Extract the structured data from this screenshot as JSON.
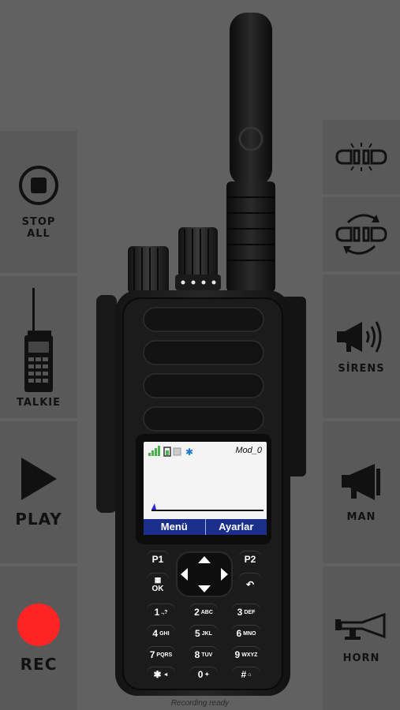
{
  "left_panel": {
    "stop_all": {
      "label_line1": "STOP",
      "label_line2": "ALL",
      "icon": "stop-icon"
    },
    "talkie": {
      "label": "TALKIE",
      "icon": "walkie-talkie-icon"
    },
    "play": {
      "label": "PLAY",
      "icon": "play-icon"
    },
    "rec": {
      "label": "REC",
      "icon": "record-icon",
      "color": "#ff2424"
    }
  },
  "right_panel": {
    "lightbar": {
      "icon": "lightbar-icon"
    },
    "lightbar_rotate": {
      "icon": "lightbar-rotate-icon"
    },
    "sirens": {
      "label": "SİRENS",
      "icon": "siren-speaker-icon"
    },
    "man": {
      "label": "MAN",
      "icon": "megaphone-icon"
    },
    "horn": {
      "label": "HORN",
      "icon": "horn-icon"
    }
  },
  "radio": {
    "screen": {
      "channel": "Mod_0",
      "softkey_left": "Menü",
      "softkey_right": "Ayarlar"
    },
    "keys": {
      "p1": "P1",
      "p2": "P2",
      "ok": "OK",
      "k1": "1",
      "k1s": ".,?",
      "k2": "2",
      "k2s": "ABC",
      "k3": "3",
      "k3s": "DEF",
      "k4": "4",
      "k4s": "GHI",
      "k5": "5",
      "k5s": "JKL",
      "k6": "6",
      "k6s": "MNO",
      "k7": "7",
      "k7s": "PQRS",
      "k8": "8",
      "k8s": "TUV",
      "k9": "9",
      "k9s": "WXYZ",
      "kstar": "✱",
      "kstars": "◄",
      "k0": "0",
      "k0s": "✦",
      "khash": "#",
      "khashs": "⌂"
    }
  },
  "status": "Recording ready"
}
